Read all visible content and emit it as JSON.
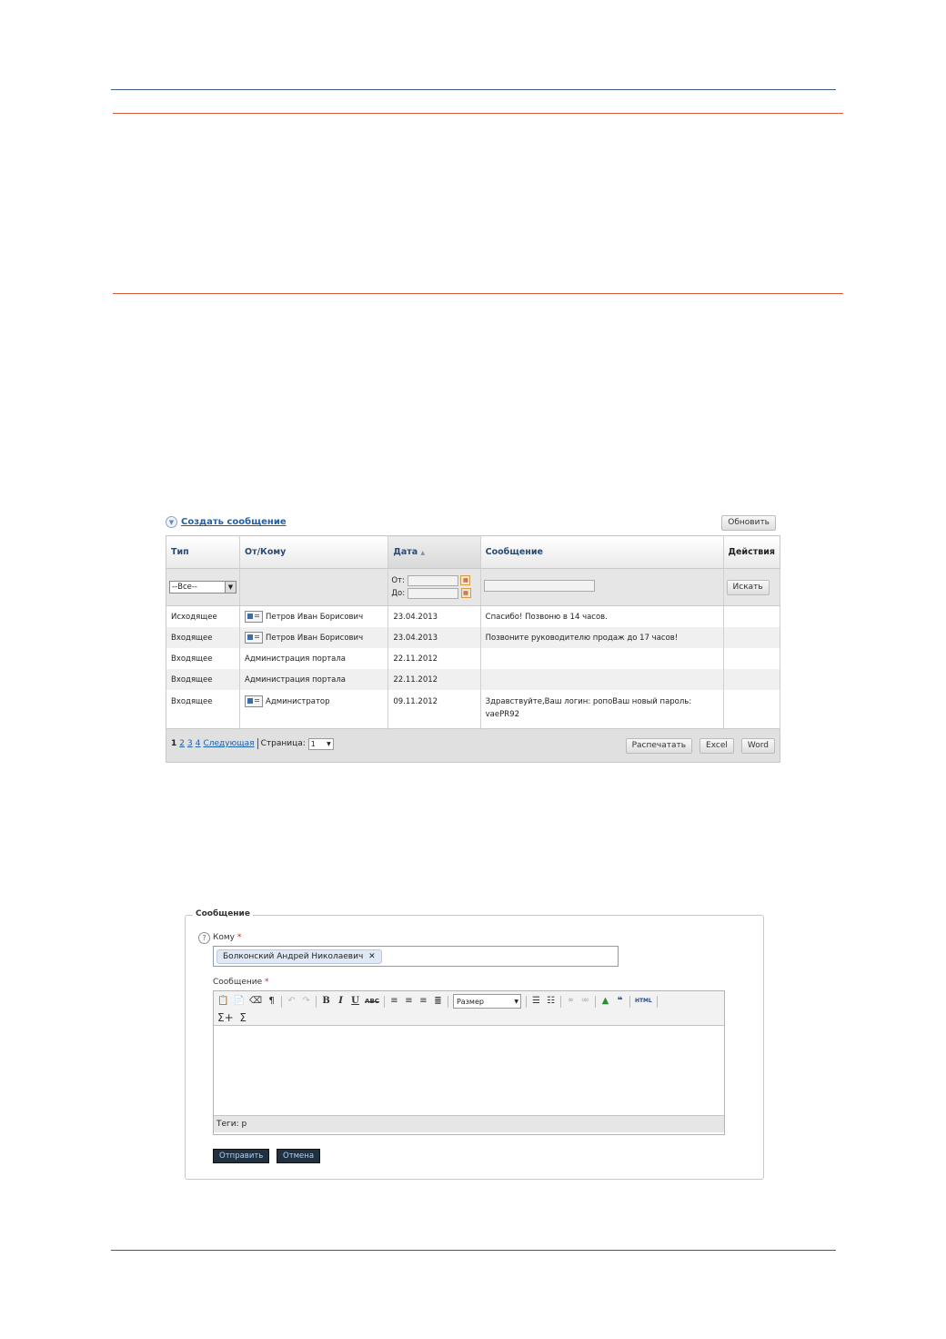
{
  "toolbar": {
    "create_label": "Создать сообщение",
    "refresh_label": "Обновить"
  },
  "table": {
    "columns": [
      "Тип",
      "От/Кому",
      "Дата",
      "Сообщение",
      "Действия"
    ],
    "sort_indicator": "▲",
    "filter": {
      "type_value": "--Все--",
      "from_label": "От:",
      "to_label": "До:",
      "search_label": "Искать"
    },
    "rows": [
      {
        "type": "Исходящее",
        "contact": "Петров Иван Борисович",
        "has_card": true,
        "date": "23.04.2013",
        "message": "Спасибо! Позвоню в 14 часов."
      },
      {
        "type": "Входящее",
        "contact": "Петров Иван Борисович",
        "has_card": true,
        "date": "23.04.2013",
        "message": "Позвоните руководителю продаж до 17 часов!"
      },
      {
        "type": "Входящее",
        "contact": "Администрация портала",
        "has_card": false,
        "date": "22.11.2012",
        "message": ""
      },
      {
        "type": "Входящее",
        "contact": "Администрация портала",
        "has_card": false,
        "date": "22.11.2012",
        "message": ""
      },
      {
        "type": "Входящее",
        "contact": "Администратор",
        "has_card": true,
        "date": "09.11.2012",
        "message": "Здравствуйте,Ваш логин: ропоВаш новый пароль: vaePR92"
      }
    ],
    "pager": {
      "pages": [
        "1",
        "2",
        "3",
        "4"
      ],
      "current": "1",
      "next_label": "Следующая",
      "page_label": "Страница:",
      "page_value": "1"
    },
    "exports": {
      "print_label": "Распечатать",
      "excel_label": "Excel",
      "word_label": "Word"
    }
  },
  "form": {
    "legend": "Сообщение",
    "to_label": "Кому",
    "recipient": "Болконский Андрей Николаевич",
    "message_label": "Сообщение",
    "required_mark": "*",
    "size_label": "Размер",
    "tags_label": "Теги: p",
    "send_label": "Отправить",
    "cancel_label": "Отмена"
  }
}
